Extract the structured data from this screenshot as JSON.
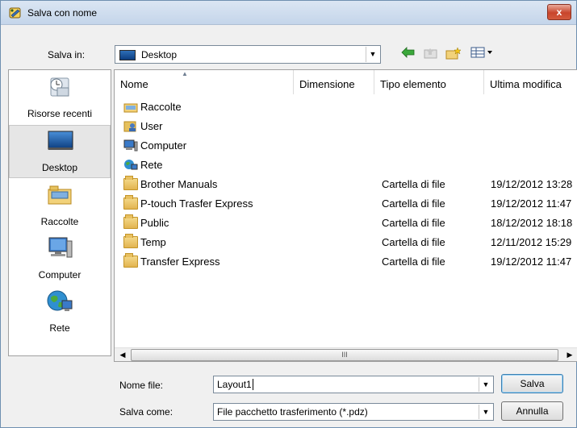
{
  "window": {
    "title": "Salva con nome",
    "close_label": "x"
  },
  "toolbar": {
    "save_in_label": "Salva in:",
    "save_in_value": "Desktop",
    "icons": [
      "back-arrow-icon",
      "up-folder-icon",
      "new-folder-icon",
      "view-menu-icon"
    ]
  },
  "places": [
    {
      "label": "Risorse recenti",
      "icon": "recent-places-icon"
    },
    {
      "label": "Desktop",
      "icon": "desktop-icon",
      "selected": true
    },
    {
      "label": "Raccolte",
      "icon": "libraries-icon"
    },
    {
      "label": "Computer",
      "icon": "computer-icon"
    },
    {
      "label": "Rete",
      "icon": "network-icon"
    }
  ],
  "columns": {
    "name": "Nome",
    "size": "Dimensione",
    "type": "Tipo elemento",
    "modified": "Ultima modifica"
  },
  "rows": [
    {
      "name": "Raccolte",
      "icon": "libraries-icon",
      "type": "",
      "modified": ""
    },
    {
      "name": "User",
      "icon": "user-icon",
      "type": "",
      "modified": ""
    },
    {
      "name": "Computer",
      "icon": "computer-icon",
      "type": "",
      "modified": ""
    },
    {
      "name": "Rete",
      "icon": "network-icon",
      "type": "",
      "modified": ""
    },
    {
      "name": "Brother Manuals",
      "icon": "folder-icon",
      "type": "Cartella di file",
      "modified": "19/12/2012 13:28"
    },
    {
      "name": "P-touch Trasfer Express",
      "icon": "folder-icon",
      "type": "Cartella di file",
      "modified": "19/12/2012 11:47"
    },
    {
      "name": "Public",
      "icon": "folder-icon",
      "type": "Cartella di file",
      "modified": "18/12/2012 18:18"
    },
    {
      "name": "Temp",
      "icon": "folder-icon",
      "type": "Cartella di file",
      "modified": "12/11/2012 15:29"
    },
    {
      "name": "Transfer Express",
      "icon": "folder-icon",
      "type": "Cartella di file",
      "modified": "19/12/2012 11:47"
    }
  ],
  "scroll": {
    "thumb_grip": "III"
  },
  "form": {
    "filename_label": "Nome file:",
    "filename_value": "Layout1",
    "savetype_label": "Salva come:",
    "savetype_value": "File pacchetto trasferimento (*.pdz)",
    "save_button": "Salva",
    "cancel_button": "Annulla"
  },
  "colors": {
    "titlebar": "#c4d5ea",
    "close": "#c8452c",
    "folder": "#e2b450"
  }
}
